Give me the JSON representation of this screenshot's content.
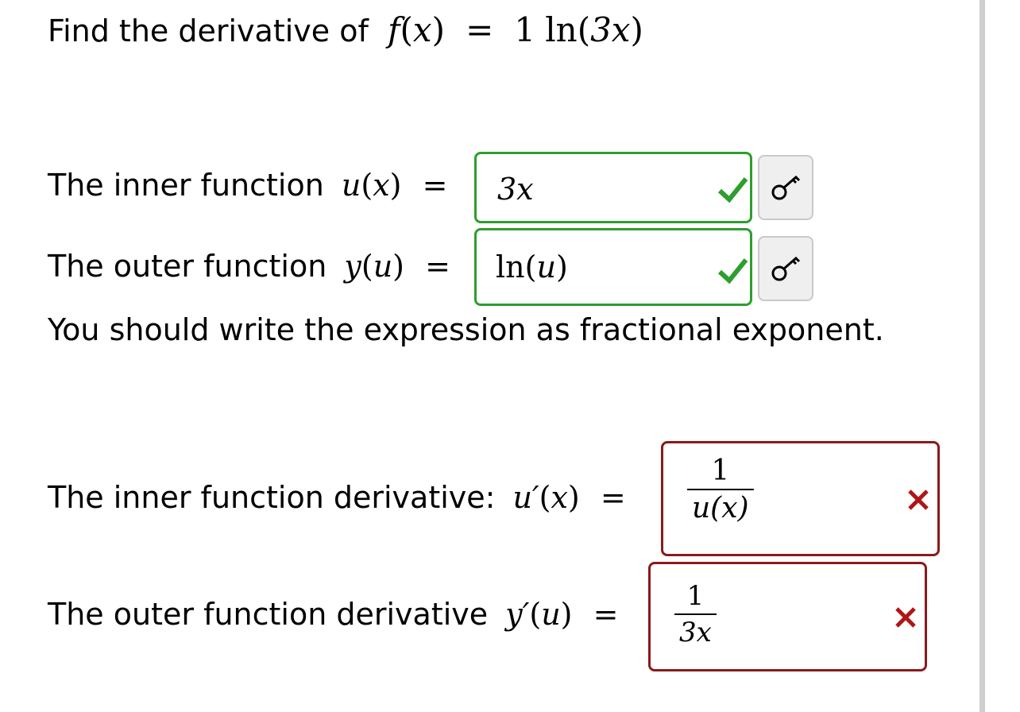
{
  "question": {
    "prefix": "Find the derivative of",
    "f_name": "f",
    "var_x": "x",
    "coef": "1",
    "fn": "ln",
    "arg": "3x"
  },
  "inner": {
    "label": "The inner function",
    "fname": "u",
    "var": "x",
    "answer": "3x",
    "status": "correct",
    "key_icon": "key-icon"
  },
  "outer": {
    "label": "The outer function",
    "fname": "y",
    "var": "u",
    "answer_fn": "ln",
    "answer_arg": "u",
    "status": "correct",
    "key_icon": "key-icon"
  },
  "hint": "You should write the expression as fractional exponent.",
  "inner_deriv": {
    "label": "The inner function derivative:",
    "fname": "u′",
    "var": "x",
    "answer_num": "1",
    "answer_den": "u(x)",
    "status": "incorrect"
  },
  "outer_deriv": {
    "label": "The outer function derivative",
    "fname": "y′",
    "var": "u",
    "answer_num": "1",
    "answer_den": "3x",
    "status": "incorrect"
  },
  "colors": {
    "correct": "#2e9e2e",
    "incorrect": "#8b1a1a",
    "incorrect_mark": "#b01515"
  }
}
